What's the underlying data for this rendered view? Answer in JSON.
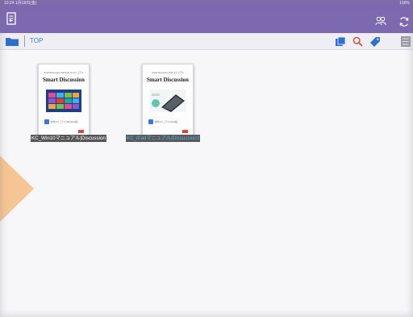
{
  "status_bar": {
    "time": "10:24  1月18日(金)",
    "right": "100%"
  },
  "top_bar": {
    "icons": [
      "exit-icon",
      "users-icon",
      "sync-icon"
    ]
  },
  "nav_bar": {
    "breadcrumb": "TOP",
    "icons": [
      "folder-icon",
      "search-icon",
      "tag-icon",
      "list-icon"
    ]
  },
  "colors": {
    "accent": "#7d69b0",
    "link": "#3d7fd1",
    "search": "#e0443a",
    "label_bg": "#555555",
    "selected_text": "#4fb6e8",
    "arrow": "#f6c594"
  },
  "books": [
    {
      "label": "KC_Win10マニュアル|Discussion",
      "cover_small": "Smart Discussion Windows 10 マニュアル",
      "cover_title": "Smart Discussion",
      "cover_caption": "操作マニュアル (Windows版)"
    },
    {
      "label": "KC_iPadマニュアル|Discussion3",
      "cover_small": "Smart Discussion iPad マニュアル",
      "cover_title": "Smart Discussion",
      "cover_caption": "操作マニュアル (iPad版)"
    }
  ]
}
